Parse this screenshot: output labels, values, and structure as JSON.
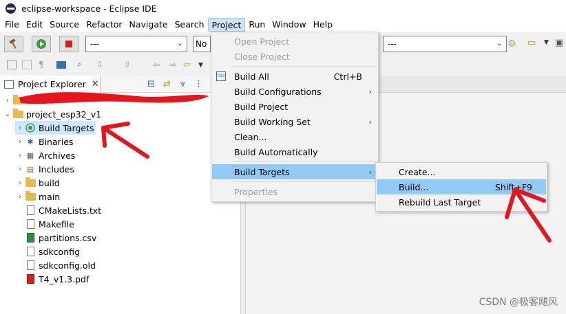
{
  "window": {
    "title": "eclipse-workspace - Eclipse IDE"
  },
  "menubar": {
    "items": [
      "File",
      "Edit",
      "Source",
      "Refactor",
      "Navigate",
      "Search",
      "Project",
      "Run",
      "Window",
      "Help"
    ],
    "active": "Project"
  },
  "toolbar": {
    "launch_mode": "---",
    "launch_config": "No",
    "launch_target": "---"
  },
  "explorer": {
    "tab_title": "Project Explorer",
    "project_name": "project_esp32_v1",
    "items": [
      {
        "label": "Build Targets",
        "icon": "build-targets-icon",
        "expandable": true,
        "selected": true
      },
      {
        "label": "Binaries",
        "icon": "binaries-icon",
        "expandable": true
      },
      {
        "label": "Archives",
        "icon": "archives-icon",
        "expandable": true
      },
      {
        "label": "Includes",
        "icon": "includes-icon",
        "expandable": true
      },
      {
        "label": "build",
        "icon": "folder-icon",
        "expandable": true
      },
      {
        "label": "main",
        "icon": "folder-icon",
        "expandable": true
      },
      {
        "label": "CMakeLists.txt",
        "icon": "text-file-icon",
        "expandable": false
      },
      {
        "label": "Makefile",
        "icon": "makefile-icon",
        "expandable": false
      },
      {
        "label": "partitions.csv",
        "icon": "csv-file-icon",
        "expandable": false
      },
      {
        "label": "sdkconfig",
        "icon": "file-icon",
        "expandable": false
      },
      {
        "label": "sdkconfig.old",
        "icon": "file-icon",
        "expandable": false
      },
      {
        "label": "T4_v1.3.pdf",
        "icon": "pdf-file-icon",
        "expandable": false
      }
    ]
  },
  "project_menu": {
    "open_project": "Open Project",
    "close_project": "Close Project",
    "build_all": "Build All",
    "build_all_shortcut": "Ctrl+B",
    "build_configurations": "Build Configurations",
    "build_project": "Build Project",
    "build_working_set": "Build Working Set",
    "clean": "Clean...",
    "build_automatically": "Build Automatically",
    "build_targets": "Build Targets",
    "properties": "Properties"
  },
  "build_targets_menu": {
    "create": "Create...",
    "build": "Build...",
    "build_shortcut": "Shift+F9",
    "rebuild_last": "Rebuild Last Target"
  },
  "watermark": "CSDN @极客飓风",
  "colors": {
    "highlight": "#91c9f7",
    "selection": "#cce8ff",
    "annotation_red": "#e8141c"
  }
}
